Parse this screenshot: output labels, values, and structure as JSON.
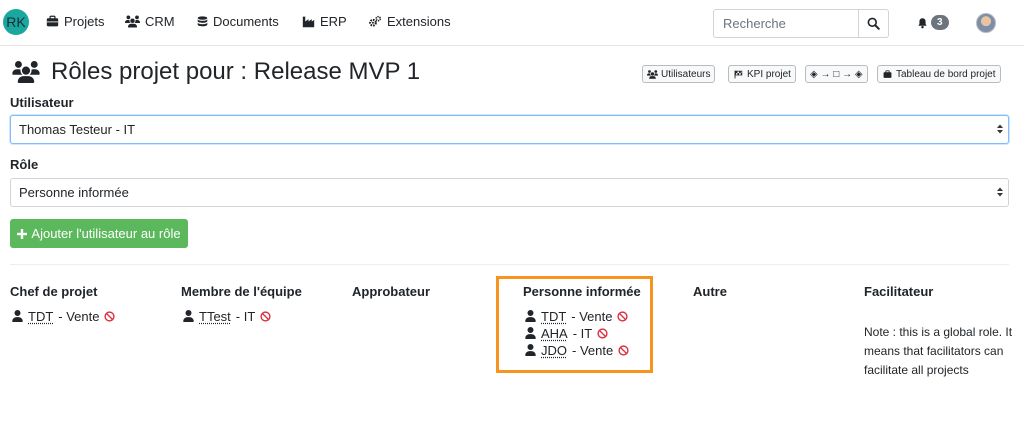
{
  "brand": {
    "initials": "RK",
    "color": "#1aa79e"
  },
  "nav": {
    "items": [
      {
        "label": "Projets",
        "icon": "briefcase-icon"
      },
      {
        "label": "CRM",
        "icon": "users-icon"
      },
      {
        "label": "Documents",
        "icon": "database-icon"
      },
      {
        "label": "ERP",
        "icon": "industry-icon"
      },
      {
        "label": "Extensions",
        "icon": "cogs-icon"
      }
    ],
    "search_placeholder": "Recherche",
    "notifications_count": "3"
  },
  "page": {
    "title": "Rôles projet pour : Release MVP 1",
    "toolbar": {
      "users_label": "Utilisateurs",
      "kpi_label": "KPI projet",
      "workflow_label": "◈ → □ → ◈",
      "dashboard_label": "Tableau de bord projet"
    }
  },
  "form": {
    "user_label": "Utilisateur",
    "user_value": "Thomas Testeur - IT",
    "role_label": "Rôle",
    "role_value": "Personne informée",
    "add_button_label": "Ajouter l'utilisateur au rôle"
  },
  "roles": {
    "project_manager": {
      "title": "Chef de projet",
      "members": [
        {
          "abbr": "TDT",
          "dept": "- Vente"
        }
      ]
    },
    "team_member": {
      "title": "Membre de l'équipe",
      "members": [
        {
          "abbr": "TTest",
          "dept": "- IT"
        }
      ]
    },
    "approver": {
      "title": "Approbateur",
      "members": []
    },
    "informed": {
      "title": "Personne informée",
      "members": [
        {
          "abbr": "TDT",
          "dept": "- Vente"
        },
        {
          "abbr": "AHA",
          "dept": "- IT"
        },
        {
          "abbr": "JDO",
          "dept": "- Vente"
        }
      ]
    },
    "other": {
      "title": "Autre",
      "members": []
    },
    "facilitator": {
      "title": "Facilitateur",
      "note": "Note : this is a global role. It means that facilitators can facilitate all projects"
    }
  },
  "colors": {
    "add_button": "#5cb85c",
    "highlight": "#f7941d",
    "remove_icon": "#dc3545"
  }
}
